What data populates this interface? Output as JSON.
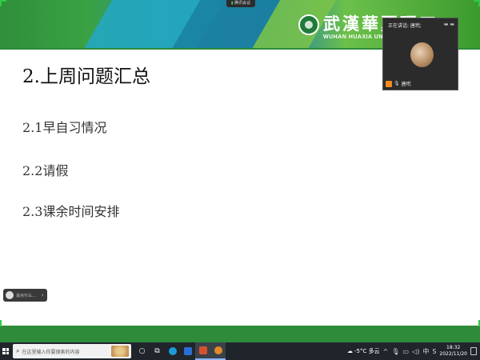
{
  "meeting": {
    "label": "腾讯会议"
  },
  "slide": {
    "brand_cn": "武漢華夏理工",
    "brand_en": "WUHAN HUAXIA UNIVERSITY",
    "title": "2.上周问题汇总",
    "items": [
      "2.1早自习情况",
      "2.2请假",
      "2.3课余时间安排"
    ],
    "colors": {
      "header_green": "#2f8f3a",
      "header_teal": "#23a7c1",
      "band_green": "#2e8b3a"
    }
  },
  "video_tile": {
    "speaking": "正在讲话: 唐玳;",
    "participant_name": "唐玳"
  },
  "chat_pill": {
    "text": "说点什么..."
  },
  "taskbar": {
    "search_placeholder": "在这里输入你要搜索的内容",
    "weather": "-5°C 多云",
    "input_method": "中",
    "time": "18:32",
    "date": "2022/11/20",
    "pinned_icons": [
      "start-icon",
      "task-view-icon",
      "file-explorer-icon",
      "edge-icon",
      "mail-icon",
      "powerpoint-icon",
      "tencent-meeting-icon"
    ]
  }
}
